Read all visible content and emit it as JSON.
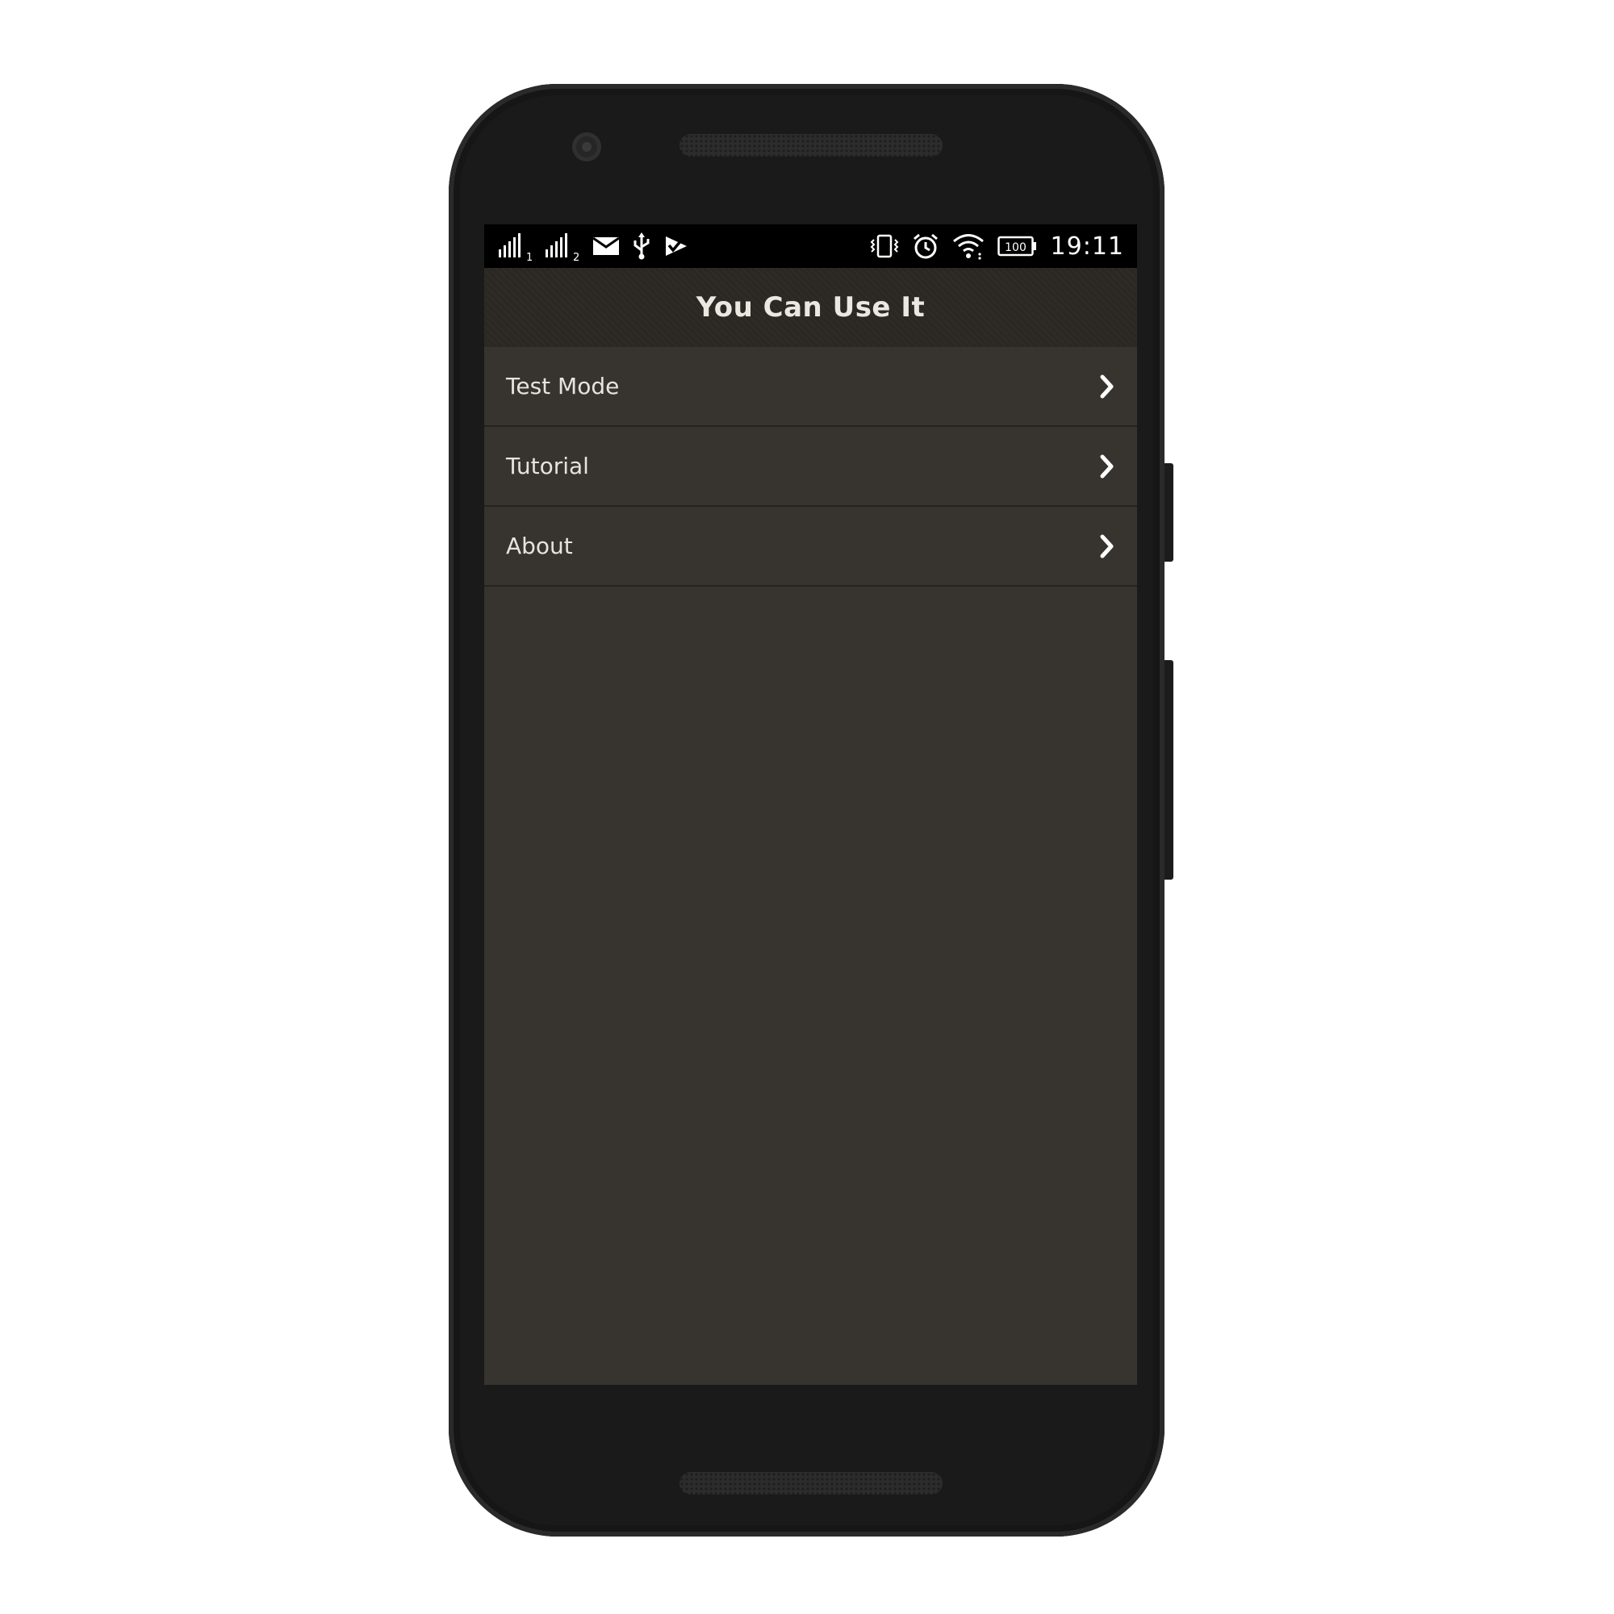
{
  "status_bar": {
    "time": "19:11",
    "battery": "100",
    "sim1_label": "1",
    "sim2_label": "2",
    "icons": [
      "signal-sim1-icon",
      "signal-sim2-icon",
      "mail-icon",
      "usb-icon",
      "checked-bag-icon",
      "vibrate-icon",
      "alarm-icon",
      "wifi-icon",
      "battery-icon"
    ]
  },
  "app_bar": {
    "title": "You Can Use It"
  },
  "menu": {
    "items": [
      {
        "label": "Test Mode",
        "icon": "chevron-right-icon"
      },
      {
        "label": "Tutorial",
        "icon": "chevron-right-icon"
      },
      {
        "label": "About",
        "icon": "chevron-right-icon"
      }
    ]
  },
  "colors": {
    "screen_bg": "#37342f",
    "app_bar_bg": "#2b2824",
    "status_bar_bg": "#000000",
    "text": "#e7e4de",
    "device_body": "#1a1a1a"
  }
}
